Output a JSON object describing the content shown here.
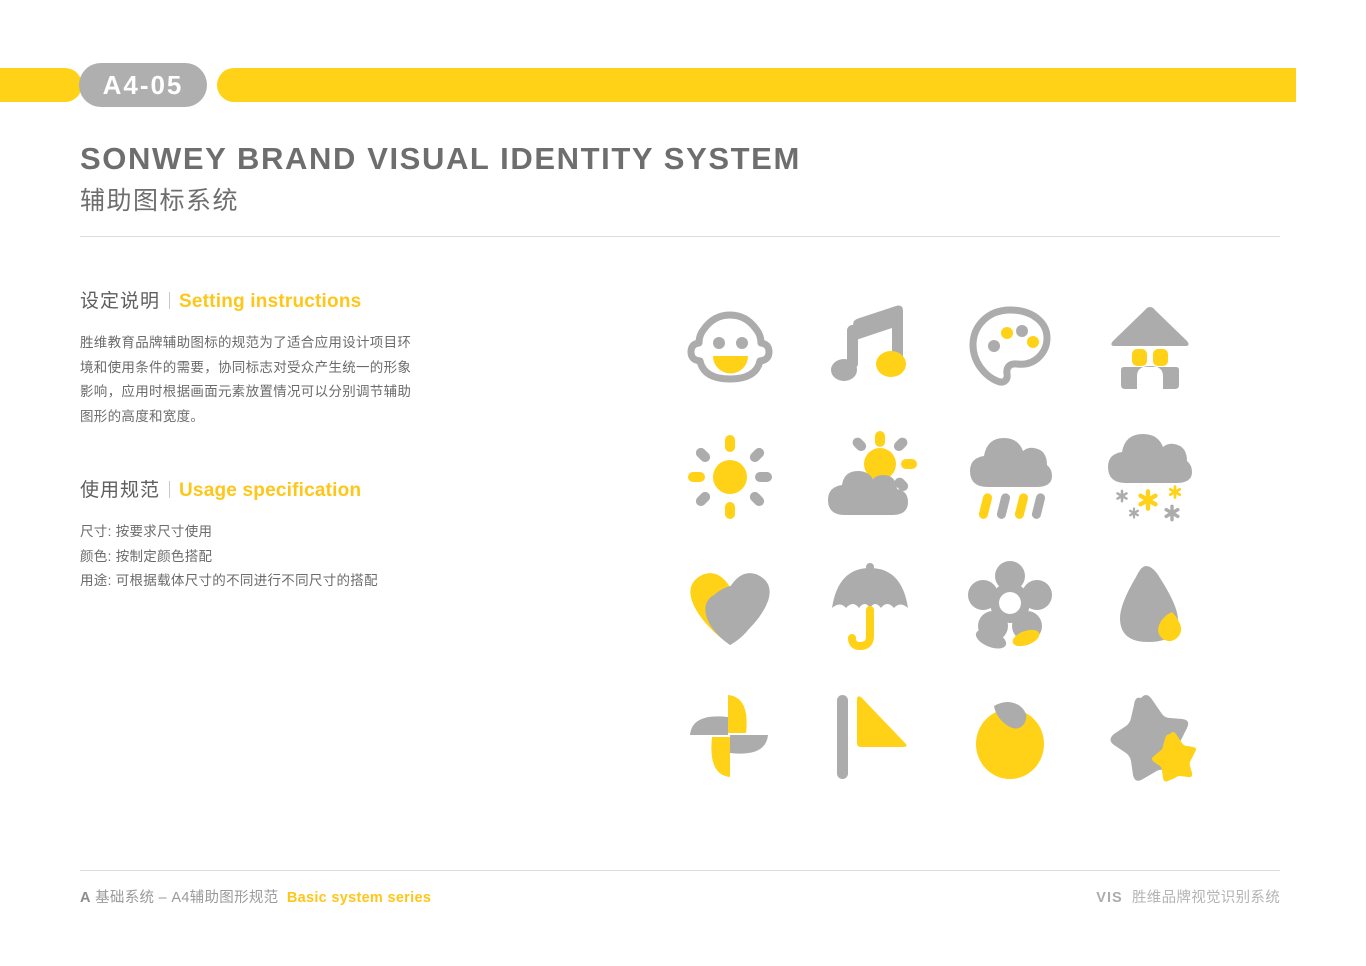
{
  "colors": {
    "yellow": "#FFD217",
    "gray": "#ACACAC",
    "text_gray": "#6B6B6B",
    "accent_yellow": "#FFC61A"
  },
  "header": {
    "code_badge": "A4-05"
  },
  "title": {
    "en": "SONWEY BRAND VISUAL IDENTITY SYSTEM",
    "cn": "辅助图标系统"
  },
  "sections": [
    {
      "cn": "设定说明",
      "en": "Setting instructions",
      "body": "胜维教育品牌辅助图标的规范为了适合应用设计项目环境和使用条件的需要，协同标志对受众产生统一的形象影响，应用时根据画面元素放置情况可以分别调节辅助图形的高度和宽度。"
    },
    {
      "cn": "使用规范",
      "en": "Usage specification",
      "lines": [
        "尺寸: 按要求尺寸使用",
        "颜色: 按制定颜色搭配",
        "用途: 可根据载体尺寸的不同进行不同尺寸的搭配"
      ]
    }
  ],
  "icons": [
    {
      "name": "smiley-face-icon",
      "label": "笑脸"
    },
    {
      "name": "music-note-icon",
      "label": "音符"
    },
    {
      "name": "paint-palette-icon",
      "label": "调色板"
    },
    {
      "name": "castle-house-icon",
      "label": "城堡"
    },
    {
      "name": "sun-icon",
      "label": "太阳"
    },
    {
      "name": "sun-behind-cloud-icon",
      "label": "多云"
    },
    {
      "name": "rain-cloud-icon",
      "label": "下雨"
    },
    {
      "name": "snow-cloud-icon",
      "label": "下雪"
    },
    {
      "name": "heart-icon",
      "label": "爱心"
    },
    {
      "name": "umbrella-icon",
      "label": "雨伞"
    },
    {
      "name": "flower-icon",
      "label": "花朵"
    },
    {
      "name": "water-drop-icon",
      "label": "水滴"
    },
    {
      "name": "pinwheel-icon",
      "label": "风车"
    },
    {
      "name": "flag-icon",
      "label": "旗帜"
    },
    {
      "name": "orange-fruit-icon",
      "label": "水果"
    },
    {
      "name": "star-icon",
      "label": "星星"
    }
  ],
  "footer": {
    "left_code": "A",
    "left_cn": "基础系统 – A4辅助图形规范",
    "left_en": "Basic system series",
    "right_vis": "VIS",
    "right_cn": "胜维品牌视觉识别系统"
  }
}
